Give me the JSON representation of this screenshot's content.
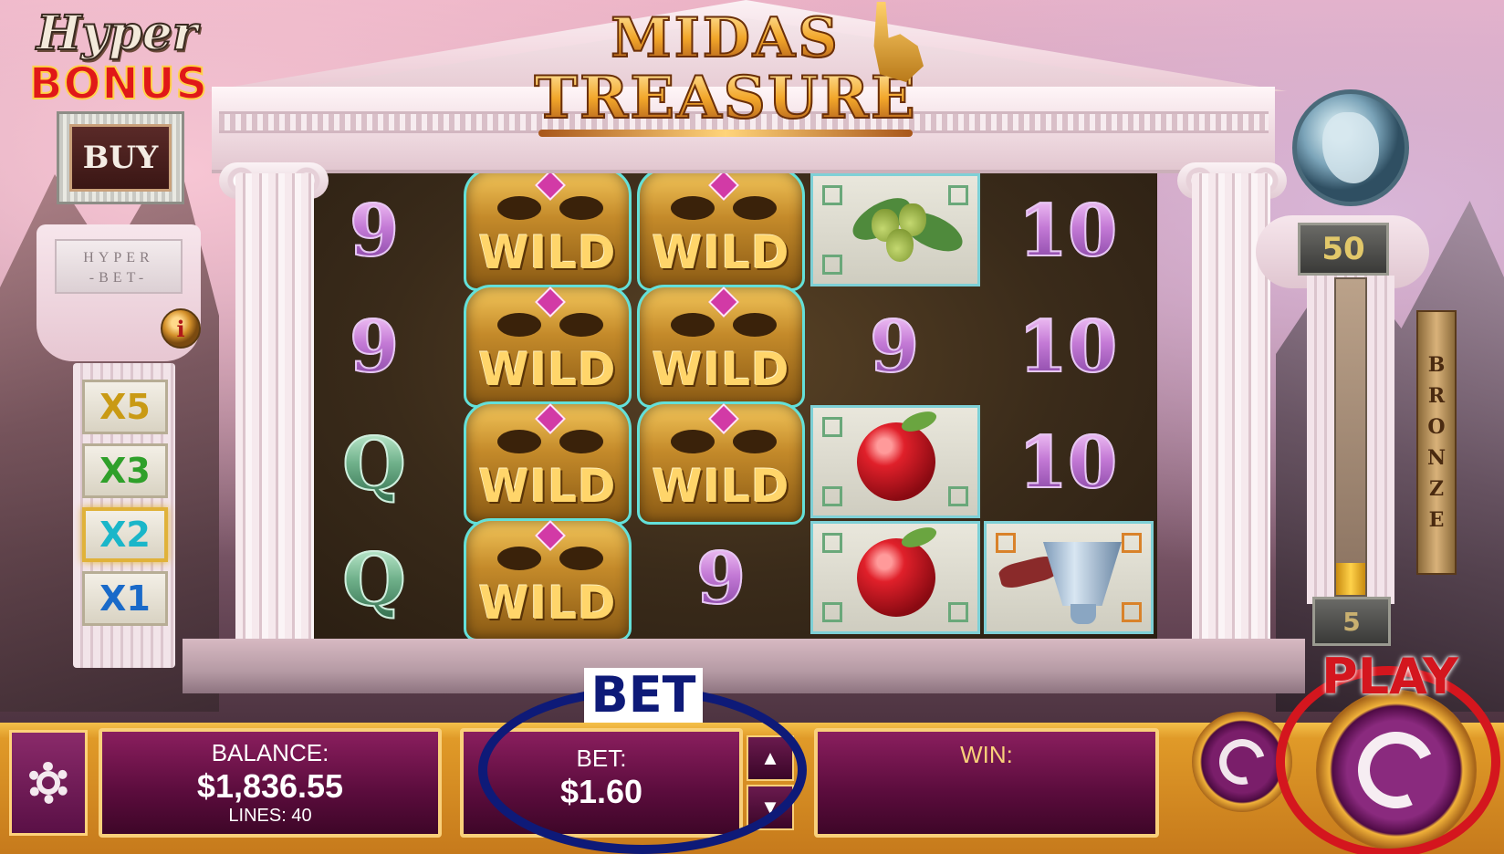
{
  "game": {
    "title_line1": "MIDAS",
    "title_line2": "TREASURE"
  },
  "hyper_bonus": {
    "logo_top": "Hyper",
    "logo_bottom": "BONUS",
    "buy_label": "BUY"
  },
  "hyper_bet": {
    "plate_line1": "HYPER",
    "plate_line2": "-BET-",
    "info_label": "i",
    "multipliers": [
      {
        "label": "X5",
        "color": "#c99a14"
      },
      {
        "label": "X3",
        "color": "#2fa02a"
      },
      {
        "label": "X2",
        "color": "#1ab6c9"
      },
      {
        "label": "X1",
        "color": "#1a6ac9"
      }
    ],
    "active_multiplier": "X2"
  },
  "meter": {
    "top_value": "50",
    "bottom_value": "5",
    "fill_fraction": 0.1,
    "tier_label": "BRONZE"
  },
  "reels": {
    "columns": [
      [
        "9",
        "9",
        "Q",
        "Q"
      ],
      [
        "WILD",
        "WILD",
        "WILD",
        "WILD"
      ],
      [
        "WILD",
        "WILD",
        "WILD",
        "9"
      ],
      [
        "acorns-icon",
        "9",
        "apple-icon",
        "apple-icon"
      ],
      [
        "10",
        "10",
        "10",
        "cup-icon"
      ]
    ]
  },
  "bottom_bar": {
    "balance_label": "BALANCE:",
    "balance_value": "$1,836.55",
    "lines_label": "LINES: 40",
    "bet_label": "BET:",
    "bet_value": "$1.60",
    "win_label": "WIN:",
    "bet_up_icon": "▲",
    "bet_down_icon": "▼",
    "bet_callout": "BET",
    "play_callout": "PLAY"
  },
  "colors": {
    "panel_border": "#f9d07a",
    "panel_fill": "#5a0c3c",
    "bet_highlight": "#0e1a78",
    "play_highlight": "#d4161e",
    "win_label": "#f9d07a"
  }
}
